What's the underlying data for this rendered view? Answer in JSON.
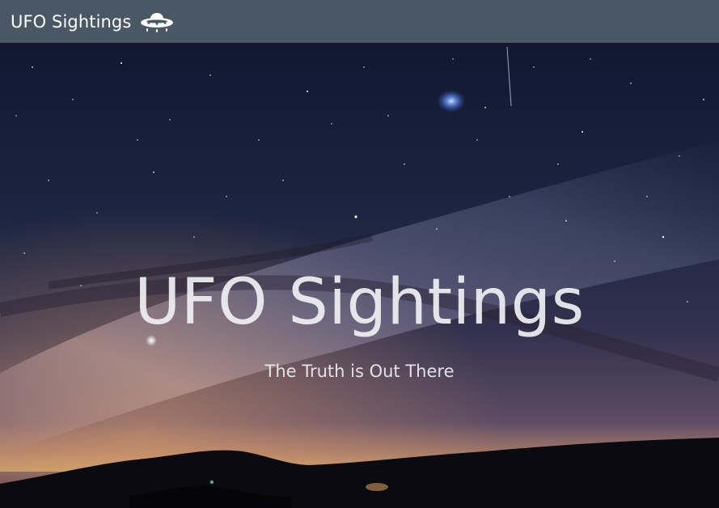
{
  "navbar": {
    "brand_label": "UFO Sightings",
    "brand_icon": "ufo-icon",
    "background": "#4a5866"
  },
  "hero": {
    "title": "UFO Sightings",
    "subtitle": "The Truth is Out There",
    "background_image": "night-sky-milky-way",
    "text_color": "#f0f0f4"
  }
}
